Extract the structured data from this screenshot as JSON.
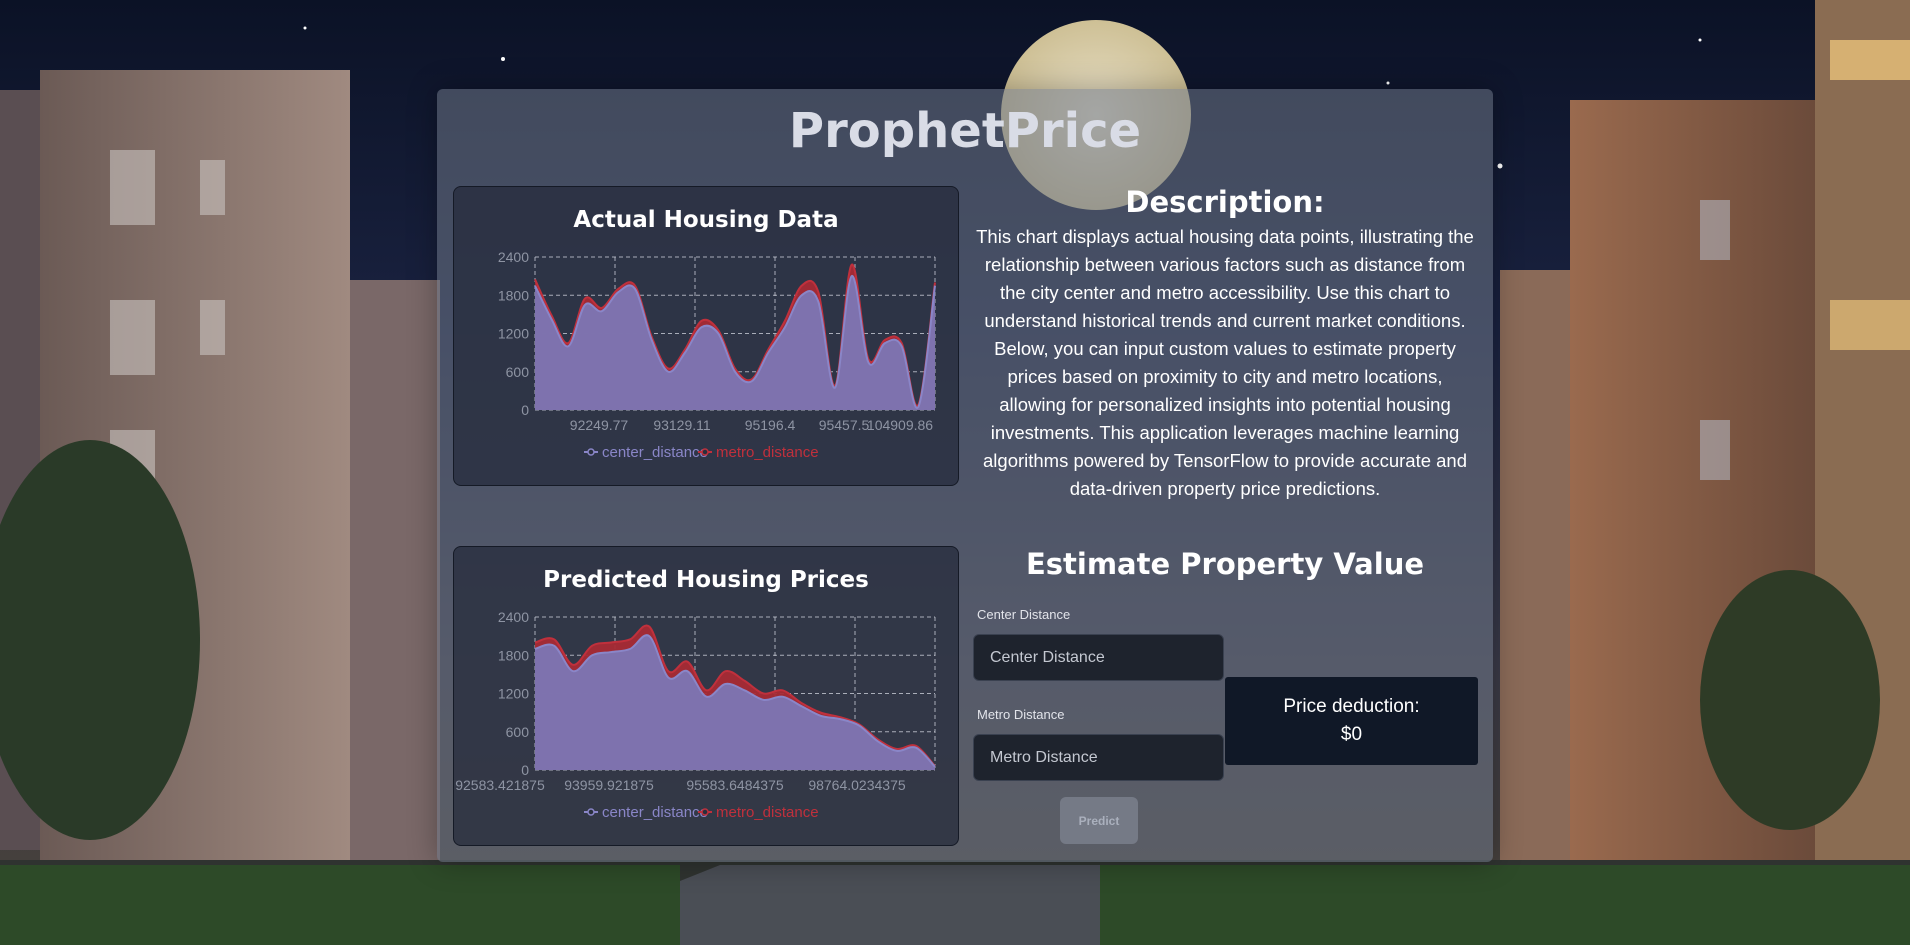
{
  "app_title": "ProphetPrice",
  "charts": [
    {
      "title": "Actual Housing Data",
      "chart_data": {
        "type": "area",
        "title": "Actual Housing Data",
        "y_ticks": [
          "2400",
          "1800",
          "1200",
          "600",
          "0"
        ],
        "x_tick_labels": [
          "92249.77",
          "93129.11",
          "95196.4",
          "95457.5",
          "104909.86"
        ],
        "ylim": [
          0,
          2400
        ],
        "grid": true,
        "legend_position": "bottom",
        "series": [
          {
            "name": "center_distance",
            "color": "#7b78b8",
            "values": [
              1950,
              1420,
              1000,
              1650,
              1550,
              1850,
              1900,
              1100,
              600,
              900,
              1300,
              1200,
              600,
              450,
              900,
              1300,
              1800,
              1700,
              350,
              2100,
              750,
              1050,
              1000,
              50,
              1950
            ]
          },
          {
            "name": "metro_distance",
            "color": "#a82a35",
            "values": [
              2050,
              1480,
              1050,
              1750,
              1600,
              1900,
              1950,
              1150,
              650,
              950,
              1400,
              1250,
              650,
              480,
              950,
              1400,
              1950,
              1850,
              380,
              2280,
              800,
              1100,
              1050,
              80,
              2000
            ]
          }
        ]
      }
    },
    {
      "title": "Predicted Housing Prices",
      "chart_data": {
        "type": "area",
        "title": "Predicted Housing Prices",
        "y_ticks": [
          "2400",
          "1800",
          "1200",
          "600",
          "0"
        ],
        "x_tick_labels": [
          "92583.421875",
          "93959.921875",
          "95583.6484375",
          "98764.0234375"
        ],
        "ylim": [
          0,
          2400
        ],
        "grid": true,
        "legend_position": "bottom",
        "series": [
          {
            "name": "center_distance",
            "color": "#7b78b8",
            "values": [
              1900,
              1950,
              1550,
              1800,
              1850,
              1900,
              2100,
              1450,
              1550,
              1150,
              1350,
              1250,
              1100,
              1150,
              1000,
              850,
              800,
              700,
              450,
              300,
              350,
              50
            ]
          },
          {
            "name": "metro_distance",
            "color": "#a82a35",
            "values": [
              2000,
              2050,
              1650,
              1950,
              2000,
              2050,
              2250,
              1550,
              1700,
              1250,
              1550,
              1400,
              1200,
              1250,
              1050,
              900,
              830,
              720,
              480,
              330,
              380,
              60
            ]
          }
        ]
      }
    }
  ],
  "description": {
    "heading": "Description:",
    "text": "This chart displays actual housing data points, illustrating the relationship between various factors such as distance from the city center and metro accessibility. Use this chart to understand historical trends and current market conditions. Below, you can input custom values to estimate property prices based on proximity to city and metro locations, allowing for personalized insights into potential housing investments. This application leverages machine learning algorithms powered by TensorFlow to provide accurate and data-driven property price predictions."
  },
  "estimate": {
    "heading": "Estimate Property Value",
    "center_label": "Center Distance",
    "center_placeholder": "Center Distance",
    "metro_label": "Metro Distance",
    "metro_placeholder": "Metro Distance",
    "result_label": "Price deduction:",
    "result_value": "$0",
    "predict_label": "Predict"
  }
}
